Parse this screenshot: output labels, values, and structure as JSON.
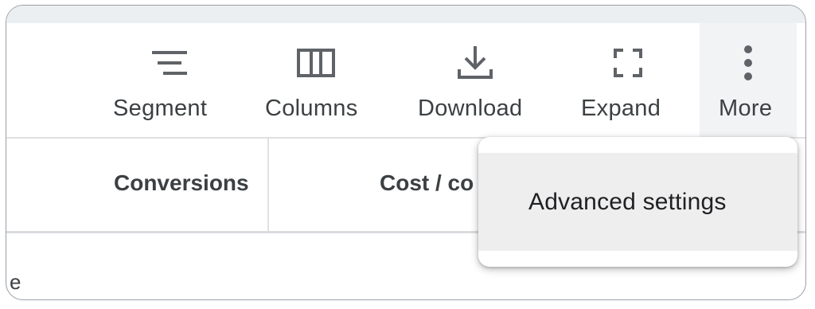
{
  "toolbar": {
    "segment_label": "Segment",
    "columns_label": "Columns",
    "download_label": "Download",
    "expand_label": "Expand",
    "more_label": "More"
  },
  "table": {
    "headers": [
      "Conversions",
      "Cost / co"
    ],
    "partial_row_text": "e"
  },
  "menu": {
    "items": [
      {
        "label": "Advanced settings",
        "highlighted": true
      }
    ]
  },
  "icons": {
    "segment": "segment-lines-icon",
    "columns": "columns-icon",
    "download": "download-icon",
    "expand": "fullscreen-icon",
    "more": "more-vert-icon"
  },
  "colors": {
    "text": "#3c4043",
    "icon": "#5f6368",
    "more_active_bg": "#f1f3f4",
    "menu_item_hover": "#eeeeee"
  }
}
